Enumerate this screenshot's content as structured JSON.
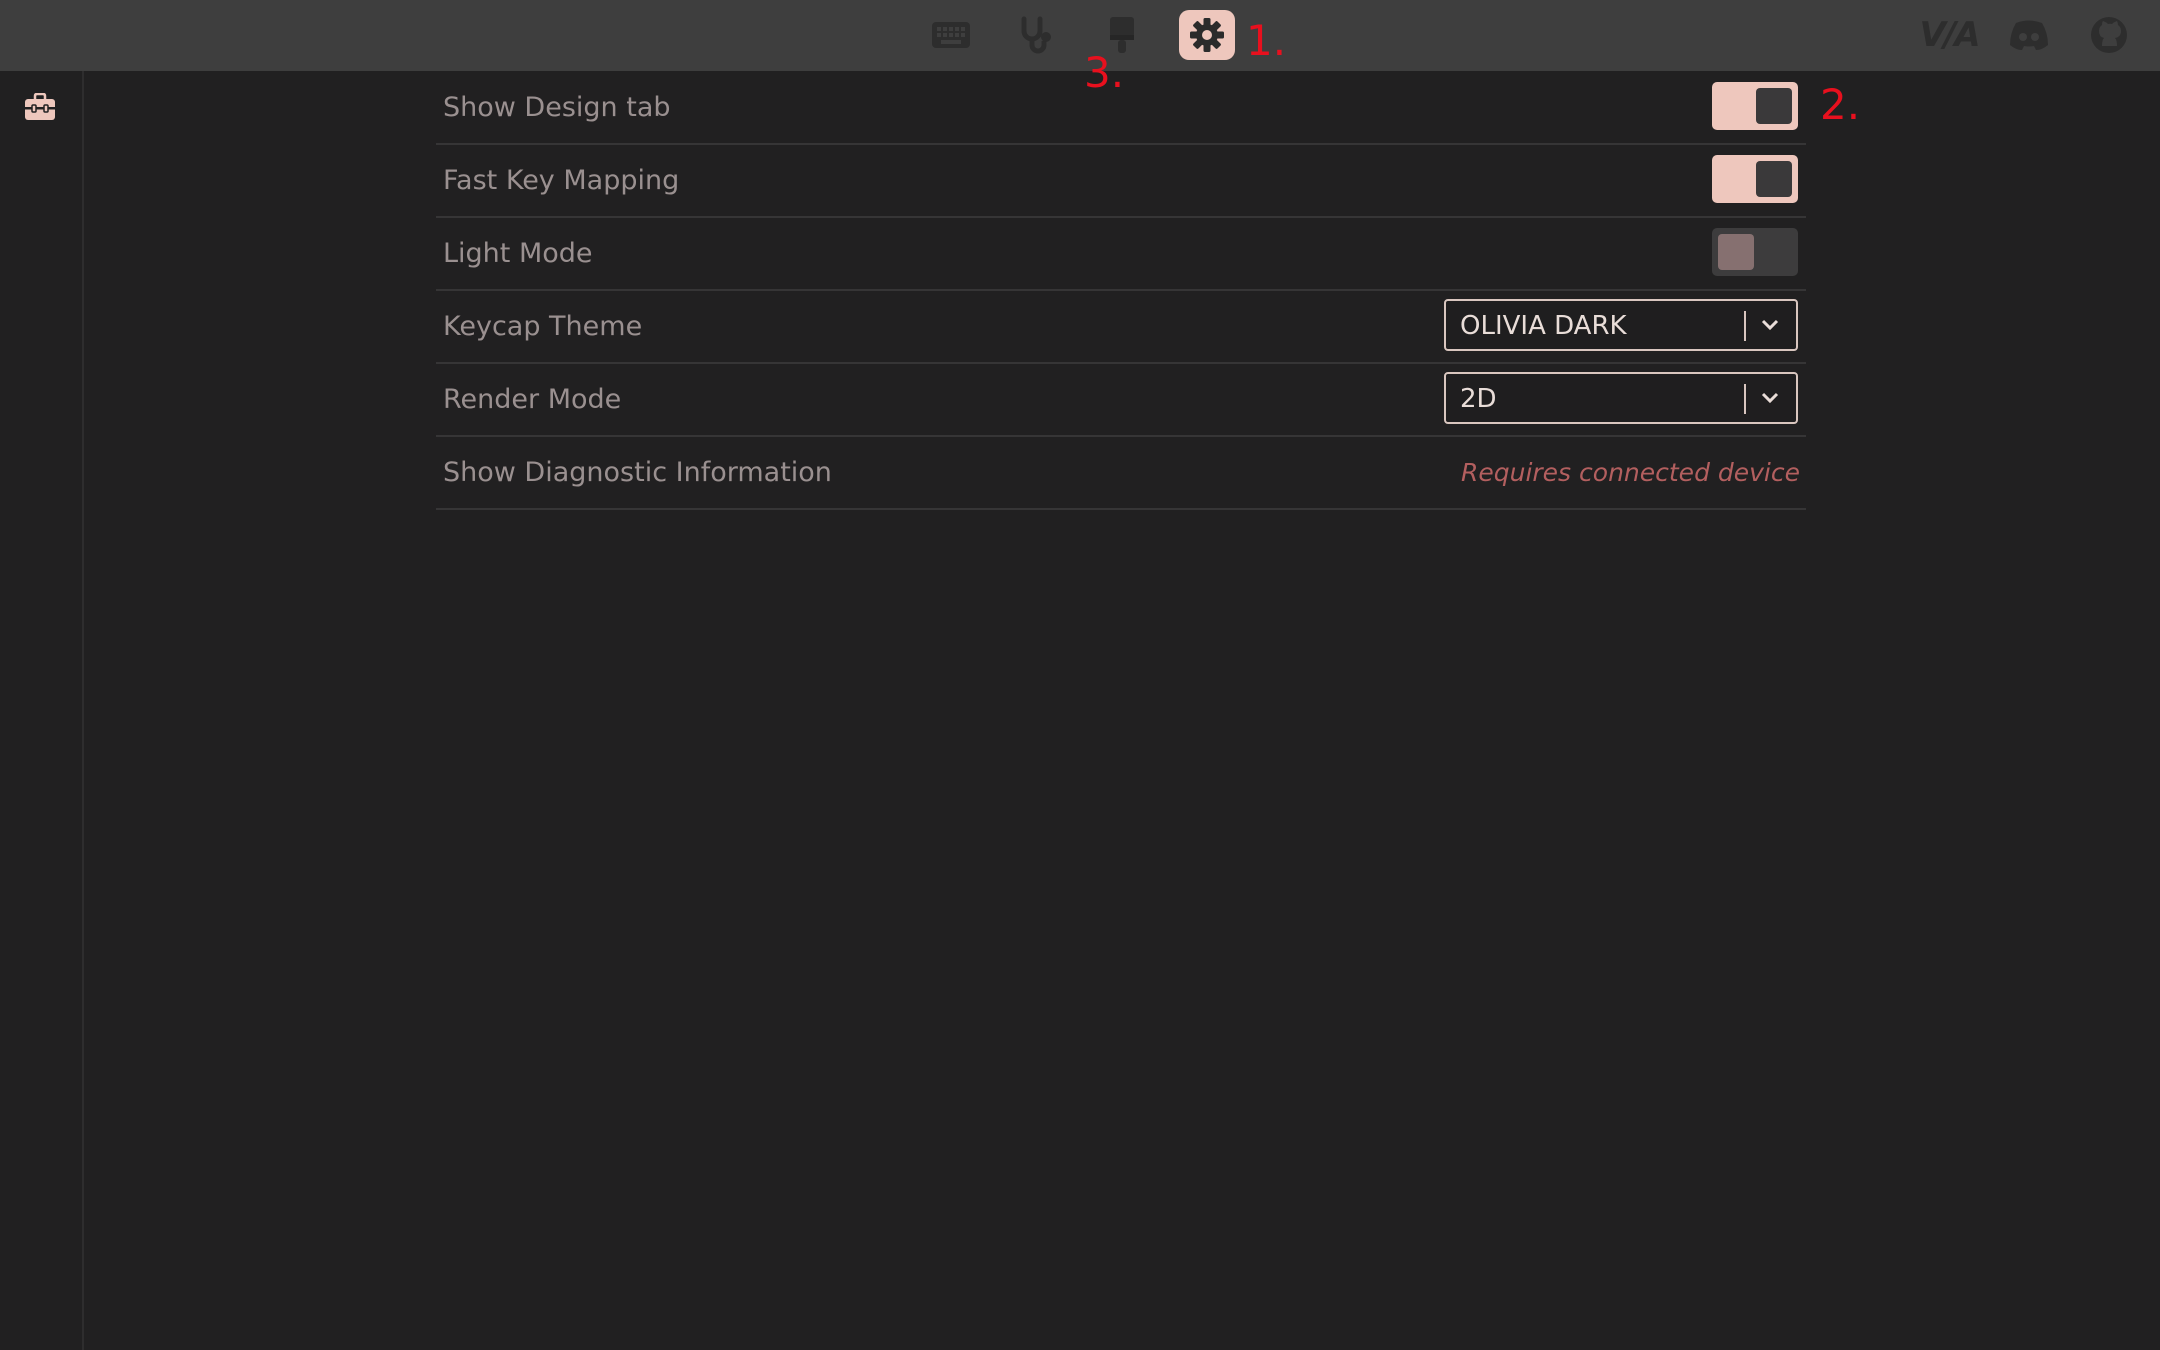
{
  "nav": {
    "tabs": [
      {
        "name": "keyboard-icon",
        "active": false
      },
      {
        "name": "stethoscope-icon",
        "active": false
      },
      {
        "name": "paintbrush-icon",
        "active": false
      },
      {
        "name": "gear-icon",
        "active": true
      }
    ],
    "right_icons": [
      "via-logo",
      "discord-icon",
      "github-icon"
    ],
    "logo_text": "V/A"
  },
  "annotations": {
    "one": "1.",
    "two": "2.",
    "three": "3."
  },
  "sidebar": {
    "icon": "toolbox-icon"
  },
  "settings": {
    "rows": [
      {
        "label": "Show Design tab",
        "control": "toggle",
        "on": true
      },
      {
        "label": "Fast Key Mapping",
        "control": "toggle",
        "on": true
      },
      {
        "label": "Light Mode",
        "control": "toggle",
        "on": false
      },
      {
        "label": "Keycap Theme",
        "control": "select",
        "value": "OLIVIA DARK"
      },
      {
        "label": "Render Mode",
        "control": "select",
        "value": "2D"
      },
      {
        "label": "Show Diagnostic Information",
        "control": "note",
        "note": "Requires connected device"
      }
    ]
  },
  "colors": {
    "accent": "#eec7bd",
    "background": "#212021",
    "topbar": "#3e3e3e",
    "annotation": "#e8101e",
    "note": "#b35f5f"
  }
}
